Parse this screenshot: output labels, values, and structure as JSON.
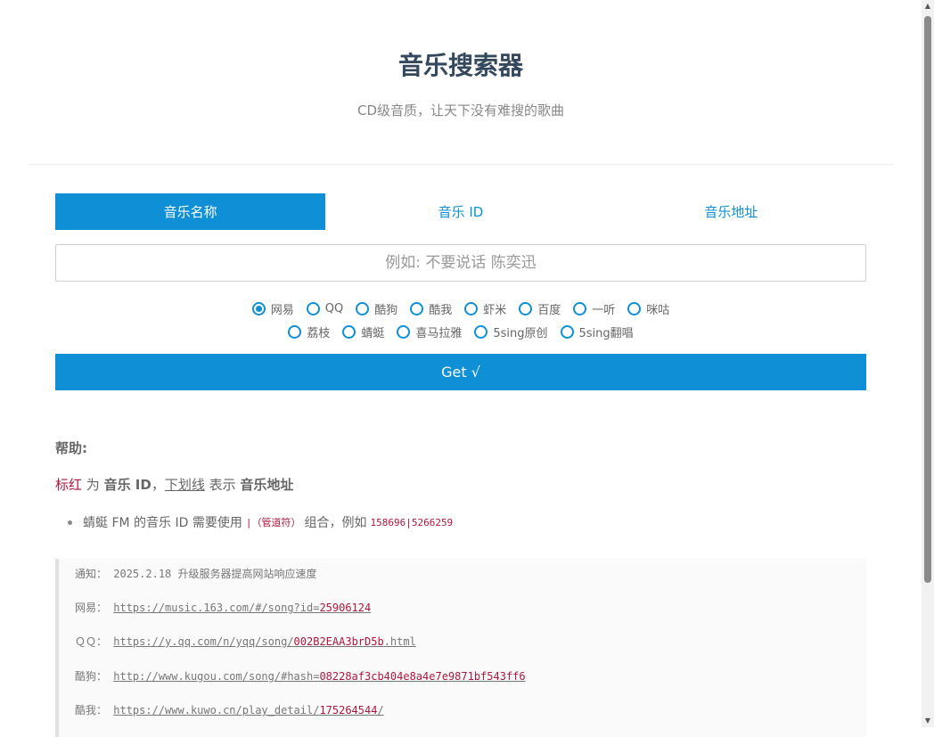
{
  "header": {
    "title": "音乐搜索器",
    "subtitle": "CD级音质，让天下没有难搜的歌曲"
  },
  "tabs": [
    {
      "label": "音乐名称",
      "active": true
    },
    {
      "label": "音乐 ID",
      "active": false
    },
    {
      "label": "音乐地址",
      "active": false
    }
  ],
  "search": {
    "placeholder": "例如: 不要说话 陈奕迅",
    "value": ""
  },
  "sources_row1": [
    {
      "label": "网易",
      "checked": true
    },
    {
      "label": "QQ",
      "checked": false
    },
    {
      "label": "酷狗",
      "checked": false
    },
    {
      "label": "酷我",
      "checked": false
    },
    {
      "label": "虾米",
      "checked": false
    },
    {
      "label": "百度",
      "checked": false
    },
    {
      "label": "一听",
      "checked": false
    },
    {
      "label": "咪咕",
      "checked": false
    }
  ],
  "sources_row2": [
    {
      "label": "荔枝",
      "checked": false
    },
    {
      "label": "蜻蜓",
      "checked": false
    },
    {
      "label": "喜马拉雅",
      "checked": false
    },
    {
      "label": "5sing原创",
      "checked": false
    },
    {
      "label": "5sing翻唱",
      "checked": false
    }
  ],
  "submit_label": "Get √",
  "help": {
    "title": "帮助:",
    "legend": {
      "red": "标红",
      "t1": " 为 ",
      "b1": "音乐 ID",
      "t2": "，",
      "underline": "下划线",
      "t3": " 表示 ",
      "b2": "音乐地址"
    },
    "bullet": {
      "t1": "蜻蜓 FM 的音乐 ID 需要使用",
      "code1": "|（管道符）",
      "t2": "组合，例如",
      "code2": "158696|5266259"
    }
  },
  "notice": {
    "label": "通知：",
    "text": "2025.2.18 升级服务器提高网站响应速度"
  },
  "examples": [
    {
      "label": "网易：",
      "prefix": "https://music.163.com/#/song?id=",
      "id": "25906124",
      "suffix": ""
    },
    {
      "label": "ＱＱ：",
      "prefix": "https://y.qq.com/n/yqq/song/",
      "id": "002B2EAA3brD5b",
      "suffix": ".html"
    },
    {
      "label": "酷狗：",
      "prefix": "http://www.kugou.com/song/#hash=",
      "id": "08228af3cb404e8a4e7e9871bf543ff6",
      "suffix": ""
    },
    {
      "label": "酷我：",
      "prefix": "https://www.kuwo.cn/play_detail/",
      "id": "175264544",
      "suffix": "/"
    }
  ],
  "colors": {
    "accent": "#0e8fd6",
    "title": "#34495e",
    "highlight": "#b0173e"
  }
}
